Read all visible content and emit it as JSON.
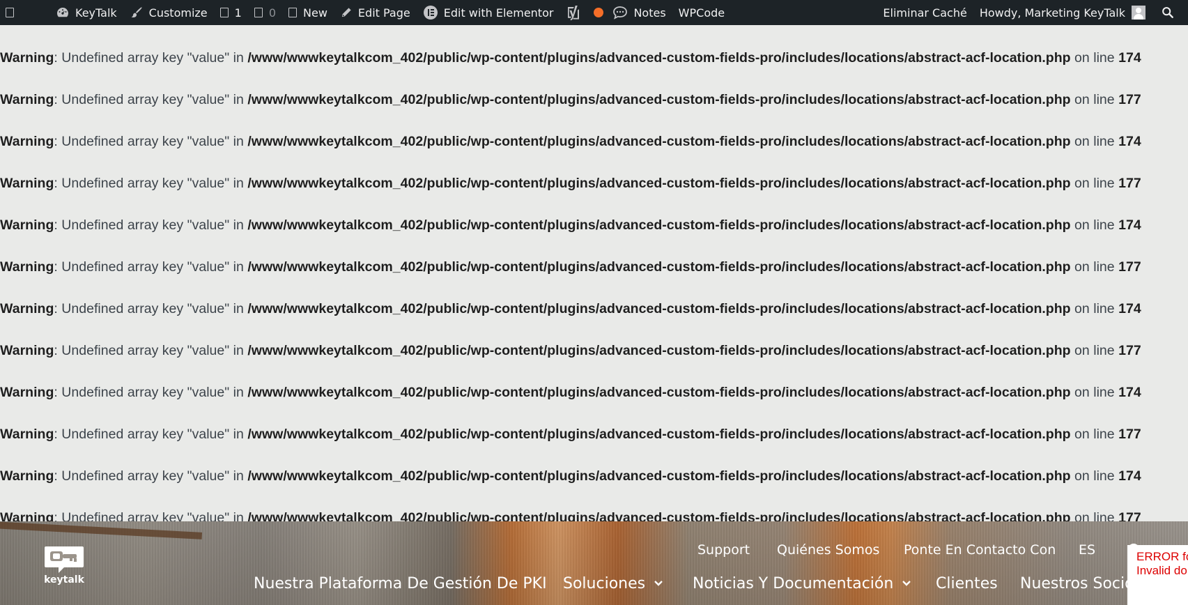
{
  "adminbar": {
    "site_name": "KeyTalk",
    "customize": "Customize",
    "updates_count": "1",
    "comments_count": "0",
    "new": "New",
    "edit_page": "Edit Page",
    "edit_elementor": "Edit with Elementor",
    "notes": "Notes",
    "wpcode": "WPCode",
    "clear_cache": "Eliminar Caché",
    "howdy": "Howdy, Marketing KeyTalk"
  },
  "warnings": [
    {
      "label": "Warning",
      "message": ": Undefined array key \"value\" in ",
      "path": "/www/wwwkeytalkcom_402/public/wp-content/plugins/advanced-custom-fields-pro/includes/locations/abstract-acf-location.php",
      "on_line": " on line ",
      "line": "174"
    },
    {
      "label": "Warning",
      "message": ": Undefined array key \"value\" in ",
      "path": "/www/wwwkeytalkcom_402/public/wp-content/plugins/advanced-custom-fields-pro/includes/locations/abstract-acf-location.php",
      "on_line": " on line ",
      "line": "177"
    },
    {
      "label": "Warning",
      "message": ": Undefined array key \"value\" in ",
      "path": "/www/wwwkeytalkcom_402/public/wp-content/plugins/advanced-custom-fields-pro/includes/locations/abstract-acf-location.php",
      "on_line": " on line ",
      "line": "174"
    },
    {
      "label": "Warning",
      "message": ": Undefined array key \"value\" in ",
      "path": "/www/wwwkeytalkcom_402/public/wp-content/plugins/advanced-custom-fields-pro/includes/locations/abstract-acf-location.php",
      "on_line": " on line ",
      "line": "177"
    },
    {
      "label": "Warning",
      "message": ": Undefined array key \"value\" in ",
      "path": "/www/wwwkeytalkcom_402/public/wp-content/plugins/advanced-custom-fields-pro/includes/locations/abstract-acf-location.php",
      "on_line": " on line ",
      "line": "174"
    },
    {
      "label": "Warning",
      "message": ": Undefined array key \"value\" in ",
      "path": "/www/wwwkeytalkcom_402/public/wp-content/plugins/advanced-custom-fields-pro/includes/locations/abstract-acf-location.php",
      "on_line": " on line ",
      "line": "177"
    },
    {
      "label": "Warning",
      "message": ": Undefined array key \"value\" in ",
      "path": "/www/wwwkeytalkcom_402/public/wp-content/plugins/advanced-custom-fields-pro/includes/locations/abstract-acf-location.php",
      "on_line": " on line ",
      "line": "174"
    },
    {
      "label": "Warning",
      "message": ": Undefined array key \"value\" in ",
      "path": "/www/wwwkeytalkcom_402/public/wp-content/plugins/advanced-custom-fields-pro/includes/locations/abstract-acf-location.php",
      "on_line": " on line ",
      "line": "177"
    },
    {
      "label": "Warning",
      "message": ": Undefined array key \"value\" in ",
      "path": "/www/wwwkeytalkcom_402/public/wp-content/plugins/advanced-custom-fields-pro/includes/locations/abstract-acf-location.php",
      "on_line": " on line ",
      "line": "174"
    },
    {
      "label": "Warning",
      "message": ": Undefined array key \"value\" in ",
      "path": "/www/wwwkeytalkcom_402/public/wp-content/plugins/advanced-custom-fields-pro/includes/locations/abstract-acf-location.php",
      "on_line": " on line ",
      "line": "177"
    },
    {
      "label": "Warning",
      "message": ": Undefined array key \"value\" in ",
      "path": "/www/wwwkeytalkcom_402/public/wp-content/plugins/advanced-custom-fields-pro/includes/locations/abstract-acf-location.php",
      "on_line": " on line ",
      "line": "174"
    },
    {
      "label": "Warning",
      "message": ": Undefined array key \"value\" in ",
      "path": "/www/wwwkeytalkcom_402/public/wp-content/plugins/advanced-custom-fields-pro/includes/locations/abstract-acf-location.php",
      "on_line": " on line ",
      "line": "177"
    }
  ],
  "header": {
    "logo_text": "keytalk",
    "top_nav": [
      "Support",
      "Quiénes Somos",
      "Ponte En Contacto Con",
      "ES"
    ],
    "main_nav": [
      "Nuestra Plataforma De Gestión De PKI",
      "Soluciones",
      "Noticias Y Documentación",
      "Clientes",
      "Nuestros Socios"
    ],
    "error_lines": [
      "ERROR fo",
      "Invalid do"
    ]
  }
}
